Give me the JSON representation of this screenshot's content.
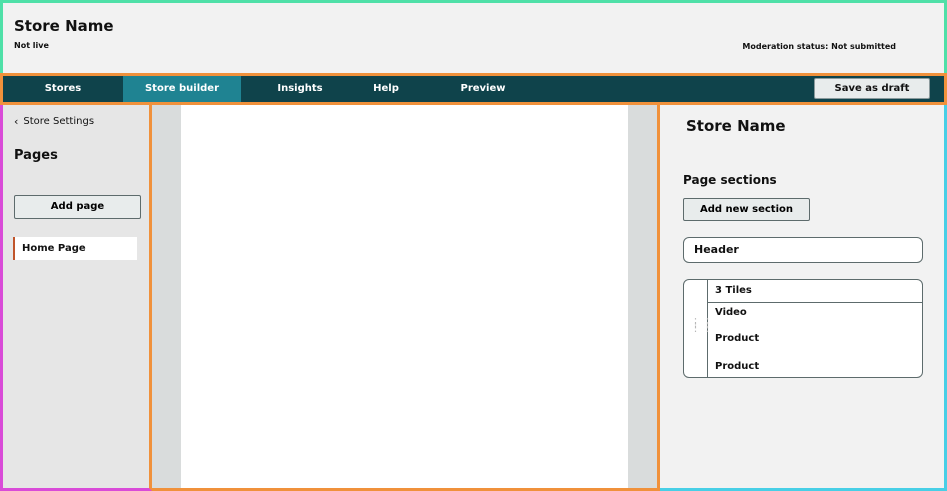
{
  "header": {
    "store_name": "Store Name",
    "live_status": "Not live",
    "moderation_status": "Moderation status: Not submitted"
  },
  "nav": {
    "tabs": [
      {
        "label": "Stores",
        "active": false
      },
      {
        "label": "Store builder",
        "active": true
      },
      {
        "label": "Insights",
        "active": false
      },
      {
        "label": "Help",
        "active": false
      },
      {
        "label": "Preview",
        "active": false
      }
    ],
    "save_label": "Save as draft"
  },
  "sidebar": {
    "back_label": "Store Settings",
    "title": "Pages",
    "add_page_label": "Add page",
    "pages": [
      {
        "label": "Home Page"
      }
    ]
  },
  "panel": {
    "store_name": "Store Name",
    "sections_title": "Page sections",
    "add_section_label": "Add new section",
    "header_section": "Header",
    "group": {
      "title": "3 Tiles",
      "items": [
        "Video",
        "Product",
        "Product"
      ]
    }
  },
  "colors": {
    "nav_bg": "#0f434b",
    "nav_active": "#1f8392",
    "page_marker": "#c0552b"
  }
}
